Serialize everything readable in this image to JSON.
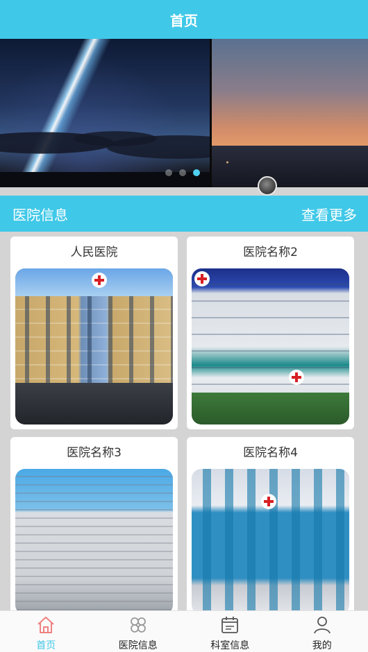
{
  "header": {
    "title": "首页"
  },
  "carousel": {
    "slide_count": 3,
    "active_index": 2
  },
  "section": {
    "title": "医院信息",
    "more_label": "查看更多"
  },
  "hospitals": [
    {
      "name": "人民医院"
    },
    {
      "name": "医院名称2"
    },
    {
      "name": "医院名称3"
    },
    {
      "name": "医院名称4"
    }
  ],
  "tabs": [
    {
      "label": "首页",
      "icon": "home-icon",
      "active": true
    },
    {
      "label": "医院信息",
      "icon": "grid-icon",
      "active": false
    },
    {
      "label": "科室信息",
      "icon": "calendar-icon",
      "active": false
    },
    {
      "label": "我的",
      "icon": "user-icon",
      "active": false
    }
  ],
  "colors": {
    "accent": "#40c8e8",
    "active_tab": "#f08080",
    "dot_active": "#4fd0f0"
  }
}
